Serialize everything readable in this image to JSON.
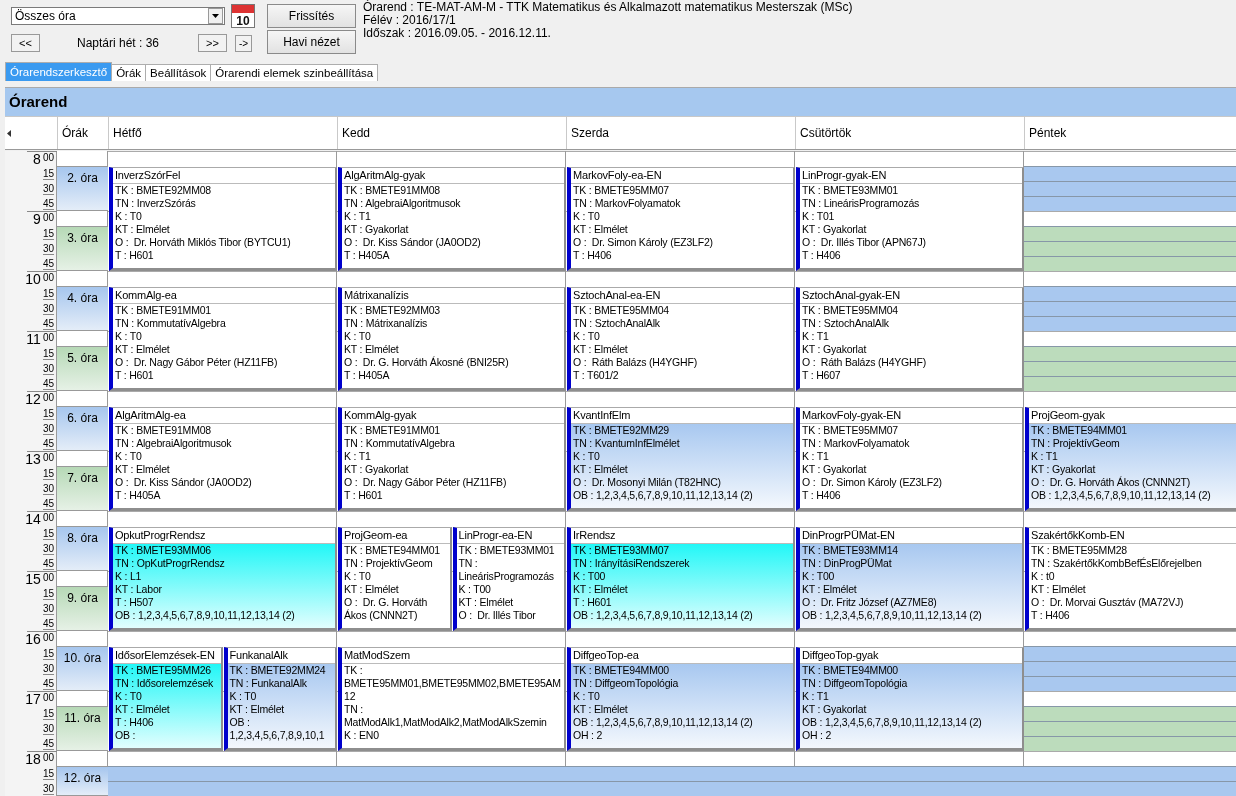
{
  "toolbar": {
    "filter": {
      "value": "Összes óra"
    },
    "calendar_day": "10",
    "prev_button": "<<",
    "week_label": "Naptári hét : 36",
    "next_button": ">>",
    "go_button": "->",
    "refresh_button": "Frissítés",
    "month_view_button": "Havi nézet"
  },
  "info": [
    "Órarend : TE-MAT-AM-M - TTK Matematikus és Alkalmazott matematikus Mesterszak (MSc)",
    "Félév : 2016/17/1",
    "Időszak : 2016.09.05. - 2016.12.11."
  ],
  "tabs": [
    {
      "label": "Órarendszerkesztő",
      "selected": true
    },
    {
      "label": "Órák",
      "selected": false
    },
    {
      "label": "Beállítások",
      "selected": false
    },
    {
      "label": "Órarendi elemek szinbeállítása",
      "selected": false
    }
  ],
  "panel_title": "Órarend",
  "periods_header": "Órák",
  "hours": [
    {
      "hour": "8",
      "minutes": [
        "00",
        "15",
        "30",
        "45"
      ]
    },
    {
      "hour": "9",
      "minutes": [
        "00",
        "15",
        "30",
        "45"
      ]
    },
    {
      "hour": "10",
      "minutes": [
        "00",
        "15",
        "30",
        "45"
      ]
    },
    {
      "hour": "11",
      "minutes": [
        "00",
        "15",
        "30",
        "45"
      ]
    },
    {
      "hour": "12",
      "minutes": [
        "00",
        "15",
        "30",
        "45"
      ]
    },
    {
      "hour": "13",
      "minutes": [
        "00",
        "15",
        "30",
        "45"
      ]
    },
    {
      "hour": "14",
      "minutes": [
        "00",
        "15",
        "30",
        "45"
      ]
    },
    {
      "hour": "15",
      "minutes": [
        "00",
        "15",
        "30",
        "45"
      ]
    },
    {
      "hour": "16",
      "minutes": [
        "00",
        "15",
        "30",
        "45"
      ]
    },
    {
      "hour": "17",
      "minutes": [
        "00",
        "15",
        "30",
        "45"
      ]
    },
    {
      "hour": "18",
      "minutes": [
        "00",
        "15",
        "30"
      ]
    }
  ],
  "periods": [
    {
      "label": "2. óra",
      "kind": "blue"
    },
    {
      "label": "3. óra",
      "kind": "green"
    },
    {
      "label": "4. óra",
      "kind": "blue"
    },
    {
      "label": "5. óra",
      "kind": "green"
    },
    {
      "label": "6. óra",
      "kind": "blue"
    },
    {
      "label": "7. óra",
      "kind": "green"
    },
    {
      "label": "8. óra",
      "kind": "blue"
    },
    {
      "label": "9. óra",
      "kind": "green"
    },
    {
      "label": "10. óra",
      "kind": "blue"
    },
    {
      "label": "11. óra",
      "kind": "green"
    },
    {
      "label": "12. óra",
      "kind": "blue"
    }
  ],
  "days": [
    {
      "name": "Hétfő",
      "blocks": [
        {
          "kind": "lessons",
          "events": [
            {
              "color": "#ffffff",
              "title": "InverzSzórFel",
              "lines": [
                "TK : BMETE92MM08",
                "TN : InverzSzórás",
                "K : T0",
                "KT : Elmélet",
                "O :  Dr. Horváth Miklós Tibor (BYTCU1)",
                "T : H601"
              ]
            }
          ]
        },
        {
          "kind": "lessons",
          "events": [
            {
              "color": "#ffffff",
              "title": "KommAlg-ea",
              "lines": [
                "TK : BMETE91MM01",
                "TN : KommutatívAlgebra",
                "K : T0",
                "KT : Elmélet",
                "O :  Dr. Nagy Gábor Péter (HZ11FB)",
                "T : H601"
              ]
            }
          ]
        },
        {
          "kind": "lessons",
          "events": [
            {
              "color": "#ffffff",
              "title": "AlgAritmAlg-ea",
              "lines": [
                "TK : BMETE91MM08",
                "TN : AlgebraiAlgoritmusok",
                "K : T0",
                "KT : Elmélet",
                "O :  Dr. Kiss Sándor (JA0OD2)",
                "T : H405A"
              ]
            }
          ]
        },
        {
          "kind": "lessons",
          "events": [
            {
              "color": "#22f7f7",
              "title": "OpkutProgrRendsz",
              "lines": [
                "TK : BMETE93MM06",
                "TN : OpKutProgrRendsz",
                "K : L1",
                "KT : Labor",
                "T : H507",
                "OB : 1,2,3,4,5,6,7,8,9,10,11,12,13,14 (2)"
              ]
            }
          ]
        },
        {
          "kind": "lessons",
          "events": [
            {
              "color": "#22f7f7",
              "title": "IdősorElemzések-EN",
              "lines": [
                "TK : BMETE95MM26",
                "TN : Idősorelemzések",
                "K : T0",
                "KT : Elmélet",
                "T : H406",
                "OB :"
              ]
            },
            {
              "color": "#a8c8f0",
              "title": "FunkanalAlk",
              "lines": [
                "TK : BMETE92MM24",
                "TN : FunkanalAlk",
                "K : T0",
                "KT : Elmélet",
                "OB : 1,2,3,4,5,6,7,8,9,10,1"
              ]
            }
          ]
        },
        {
          "kind": "free"
        }
      ]
    },
    {
      "name": "Kedd",
      "blocks": [
        {
          "kind": "lessons",
          "events": [
            {
              "color": "#ffffff",
              "title": "AlgAritmAlg-gyak",
              "lines": [
                "TK : BMETE91MM08",
                "TN : AlgebraiAlgoritmusok",
                "K : T1",
                "KT : Gyakorlat",
                "O :  Dr. Kiss Sándor (JA0OD2)",
                "T : H405A"
              ]
            }
          ]
        },
        {
          "kind": "lessons",
          "events": [
            {
              "color": "#ffffff",
              "title": "Mátrixanalízis",
              "lines": [
                "TK : BMETE92MM03",
                "TN : Mátrixanalízis",
                "K : T0",
                "KT : Elmélet",
                "O :  Dr. G. Horváth Ákosné (BNI25R)",
                "T : H405A"
              ]
            }
          ]
        },
        {
          "kind": "lessons",
          "events": [
            {
              "color": "#ffffff",
              "title": "KommAlg-gyak",
              "lines": [
                "TK : BMETE91MM01",
                "TN : KommutatívAlgebra",
                "K : T1",
                "KT : Gyakorlat",
                "O :  Dr. Nagy Gábor Péter (HZ11FB)",
                "T : H601"
              ]
            }
          ]
        },
        {
          "kind": "lessons",
          "events": [
            {
              "color": "#ffffff",
              "title": "ProjGeom-ea",
              "lines": [
                "TK : BMETE94MM01",
                "TN : ProjektívGeom",
                "K : T0",
                "KT : Elmélet",
                "O :  Dr. G. Horváth Ákos (CNNN2T)"
              ]
            },
            {
              "color": "#ffffff",
              "title": "LinProgr-ea-EN",
              "lines": [
                "TK : BMETE93MM01",
                "TN : LineárisProgramozás",
                "K : T00",
                "KT : Elmélet",
                "O :  Dr. Illés Tibor"
              ]
            }
          ]
        },
        {
          "kind": "lessons",
          "events": [
            {
              "color": "#ffffff",
              "title": "MatModSzem",
              "lines": [
                "TK : BMETE95MM01,BMETE95MM02,BMETE95AM12",
                "TN : MatModAlk1,MatModAlk2,MatModAlkSzemin",
                "K : EN0"
              ]
            }
          ]
        },
        {
          "kind": "free"
        }
      ]
    },
    {
      "name": "Szerda",
      "blocks": [
        {
          "kind": "lessons",
          "events": [
            {
              "color": "#ffffff",
              "title": "MarkovFoly-ea-EN",
              "lines": [
                "TK : BMETE95MM07",
                "TN : MarkovFolyamatok",
                "K : T0",
                "KT : Elmélet",
                "O :  Dr. Simon Károly (EZ3LF2)",
                "T : H406"
              ]
            }
          ]
        },
        {
          "kind": "lessons",
          "events": [
            {
              "color": "#ffffff",
              "title": "SztochAnal-ea-EN",
              "lines": [
                "TK : BMETE95MM04",
                "TN : SztochAnalAlk",
                "K : T0",
                "KT : Elmélet",
                "O :  Ráth Balázs (H4YGHF)",
                "T : T601/2"
              ]
            }
          ]
        },
        {
          "kind": "lessons",
          "events": [
            {
              "color": "#a8c8f0",
              "title": "KvantInfElm",
              "lines": [
                "TK : BMETE92MM29",
                "TN : KvantumInfElmélet",
                "K : T0",
                "KT : Elmélet",
                "O :  Dr. Mosonyi Milán (T82HNC)",
                "OB : 1,2,3,4,5,6,7,8,9,10,11,12,13,14 (2)"
              ]
            }
          ]
        },
        {
          "kind": "lessons",
          "events": [
            {
              "color": "#22f7f7",
              "title": "IrRendsz",
              "lines": [
                "TK : BMETE93MM07",
                "TN : IrányításiRendszerek",
                "K : T00",
                "KT : Elmélet",
                "T : H601",
                "OB : 1,2,3,4,5,6,7,8,9,10,11,12,13,14 (2)"
              ]
            }
          ]
        },
        {
          "kind": "lessons",
          "events": [
            {
              "color": "#a8c8f0",
              "title": "DiffgeoTop-ea",
              "lines": [
                "TK : BMETE94MM00",
                "TN : DiffgeomTopológia",
                "K : T0",
                "KT : Elmélet",
                "OB : 1,2,3,4,5,6,7,8,9,10,11,12,13,14 (2)",
                "OH : 2"
              ]
            }
          ]
        },
        {
          "kind": "free"
        }
      ]
    },
    {
      "name": "Csütörtök",
      "blocks": [
        {
          "kind": "lessons",
          "events": [
            {
              "color": "#ffffff",
              "title": "LinProgr-gyak-EN",
              "lines": [
                "TK : BMETE93MM01",
                "TN : LineárisProgramozás",
                "K : T01",
                "KT : Gyakorlat",
                "O :  Dr. Illés Tibor (APN67J)",
                "T : H406"
              ]
            }
          ]
        },
        {
          "kind": "lessons",
          "events": [
            {
              "color": "#ffffff",
              "title": "SztochAnal-gyak-EN",
              "lines": [
                "TK : BMETE95MM04",
                "TN : SztochAnalAlk",
                "K : T1",
                "KT : Gyakorlat",
                "O :  Ráth Balázs (H4YGHF)",
                "T : H607"
              ]
            }
          ]
        },
        {
          "kind": "lessons",
          "events": [
            {
              "color": "#ffffff",
              "title": "MarkovFoly-gyak-EN",
              "lines": [
                "TK : BMETE95MM07",
                "TN : MarkovFolyamatok",
                "K : T1",
                "KT : Gyakorlat",
                "O :  Dr. Simon Károly (EZ3LF2)",
                "T : H406"
              ]
            }
          ]
        },
        {
          "kind": "lessons",
          "events": [
            {
              "color": "#a8c8f0",
              "title": "DinProgrPÜMat-EN",
              "lines": [
                "TK : BMETE93MM14",
                "TN : DinProgPÜMat",
                "K : T00",
                "KT : Elmélet",
                "O :  Dr. Fritz József (AZ7ME8)",
                "OB : 1,2,3,4,5,6,7,8,9,10,11,12,13,14 (2)"
              ]
            }
          ]
        },
        {
          "kind": "lessons",
          "events": [
            {
              "color": "#a8c8f0",
              "title": "DiffgeoTop-gyak",
              "lines": [
                "TK : BMETE94MM00",
                "TN : DiffgeomTopológia",
                "K : T1",
                "KT : Gyakorlat",
                "OB : 1,2,3,4,5,6,7,8,9,10,11,12,13,14 (2)",
                "OH : 2"
              ]
            }
          ]
        },
        {
          "kind": "free"
        }
      ]
    },
    {
      "name": "Péntek",
      "blocks": [
        {
          "kind": "free"
        },
        {
          "kind": "free"
        },
        {
          "kind": "lessons",
          "events": [
            {
              "color": "#a8c8f0",
              "title": "ProjGeom-gyak",
              "lines": [
                "TK : BMETE94MM01",
                "TN : ProjektívGeom",
                "K : T1",
                "KT : Gyakorlat",
                "O :  Dr. G. Horváth Ákos (CNNN2T)",
                "OB : 1,2,3,4,5,6,7,8,9,10,11,12,13,14 (2)"
              ]
            }
          ]
        },
        {
          "kind": "lessons",
          "events": [
            {
              "color": "#ffffff",
              "title": "SzakértőkKomb-EN",
              "lines": [
                "TK : BMETE95MM28",
                "TN : SzakértőkKombBefÉsElőrejelben",
                "K : t0",
                "KT : Elmélet",
                "O :  Dr. Morvai Gusztáv (MA72VJ)",
                "T : H406"
              ]
            }
          ]
        },
        {
          "kind": "free"
        },
        {
          "kind": "free"
        }
      ]
    }
  ]
}
